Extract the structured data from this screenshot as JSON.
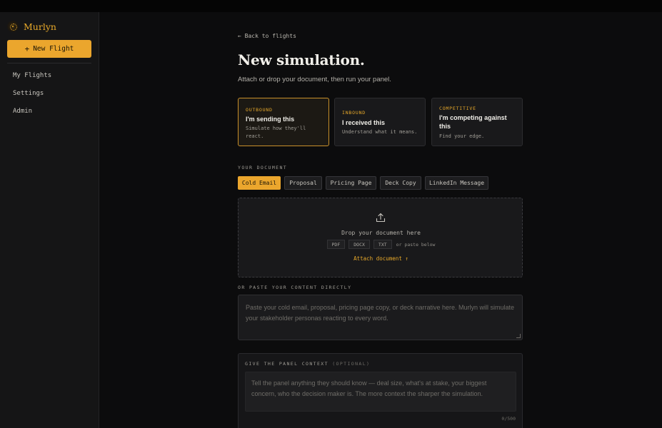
{
  "brand": {
    "name": "Murlyn"
  },
  "sidebar": {
    "new_flight_label": "New Flight",
    "nav": [
      {
        "label": "My Flights"
      },
      {
        "label": "Settings"
      },
      {
        "label": "Admin"
      }
    ]
  },
  "main": {
    "back_label": "← Back to flights",
    "title": "New simulation.",
    "subtitle": "Attach or drop your document, then run your panel."
  },
  "modes": [
    {
      "kicker": "OUTBOUND",
      "title": "I'm sending this",
      "desc": "Simulate how they'll react.",
      "selected": true
    },
    {
      "kicker": "INBOUND",
      "title": "I received this",
      "desc": "Understand what it means.",
      "selected": false
    },
    {
      "kicker": "COMPETITIVE",
      "title": "I'm competing against this",
      "desc": "Find your edge.",
      "selected": false
    }
  ],
  "document": {
    "section_label": "YOUR DOCUMENT",
    "types": [
      {
        "label": "Cold Email",
        "selected": true
      },
      {
        "label": "Proposal",
        "selected": false
      },
      {
        "label": "Pricing Page",
        "selected": false
      },
      {
        "label": "Deck Copy",
        "selected": false
      },
      {
        "label": "LinkedIn Message",
        "selected": false
      }
    ],
    "drop_text": "Drop your document here",
    "file_types": [
      "PDF",
      "DOCX",
      "TXT"
    ],
    "file_note": "or paste below",
    "attach_label": "Attach document ↑"
  },
  "paste": {
    "section_label": "OR PASTE YOUR CONTENT DIRECTLY",
    "placeholder": "Paste your cold email, proposal, pricing page copy, or deck narrative here. Murlyn will simulate your stakeholder personas reacting to every word."
  },
  "context": {
    "label": "GIVE THE PANEL CONTEXT",
    "optional": "(OPTIONAL)",
    "placeholder": "Tell the panel anything they should know — deal size, what's at stake, your biggest concern, who the decision maker is. The more context the sharper the simulation.",
    "counter": "0/500"
  },
  "colors": {
    "accent": "#eba62d",
    "background": "#0c0c0d",
    "sidebar": "#151516"
  },
  "icons": {
    "upload": "upload-icon",
    "plus": "plus-icon",
    "logo": "murlyn-logo-icon"
  }
}
